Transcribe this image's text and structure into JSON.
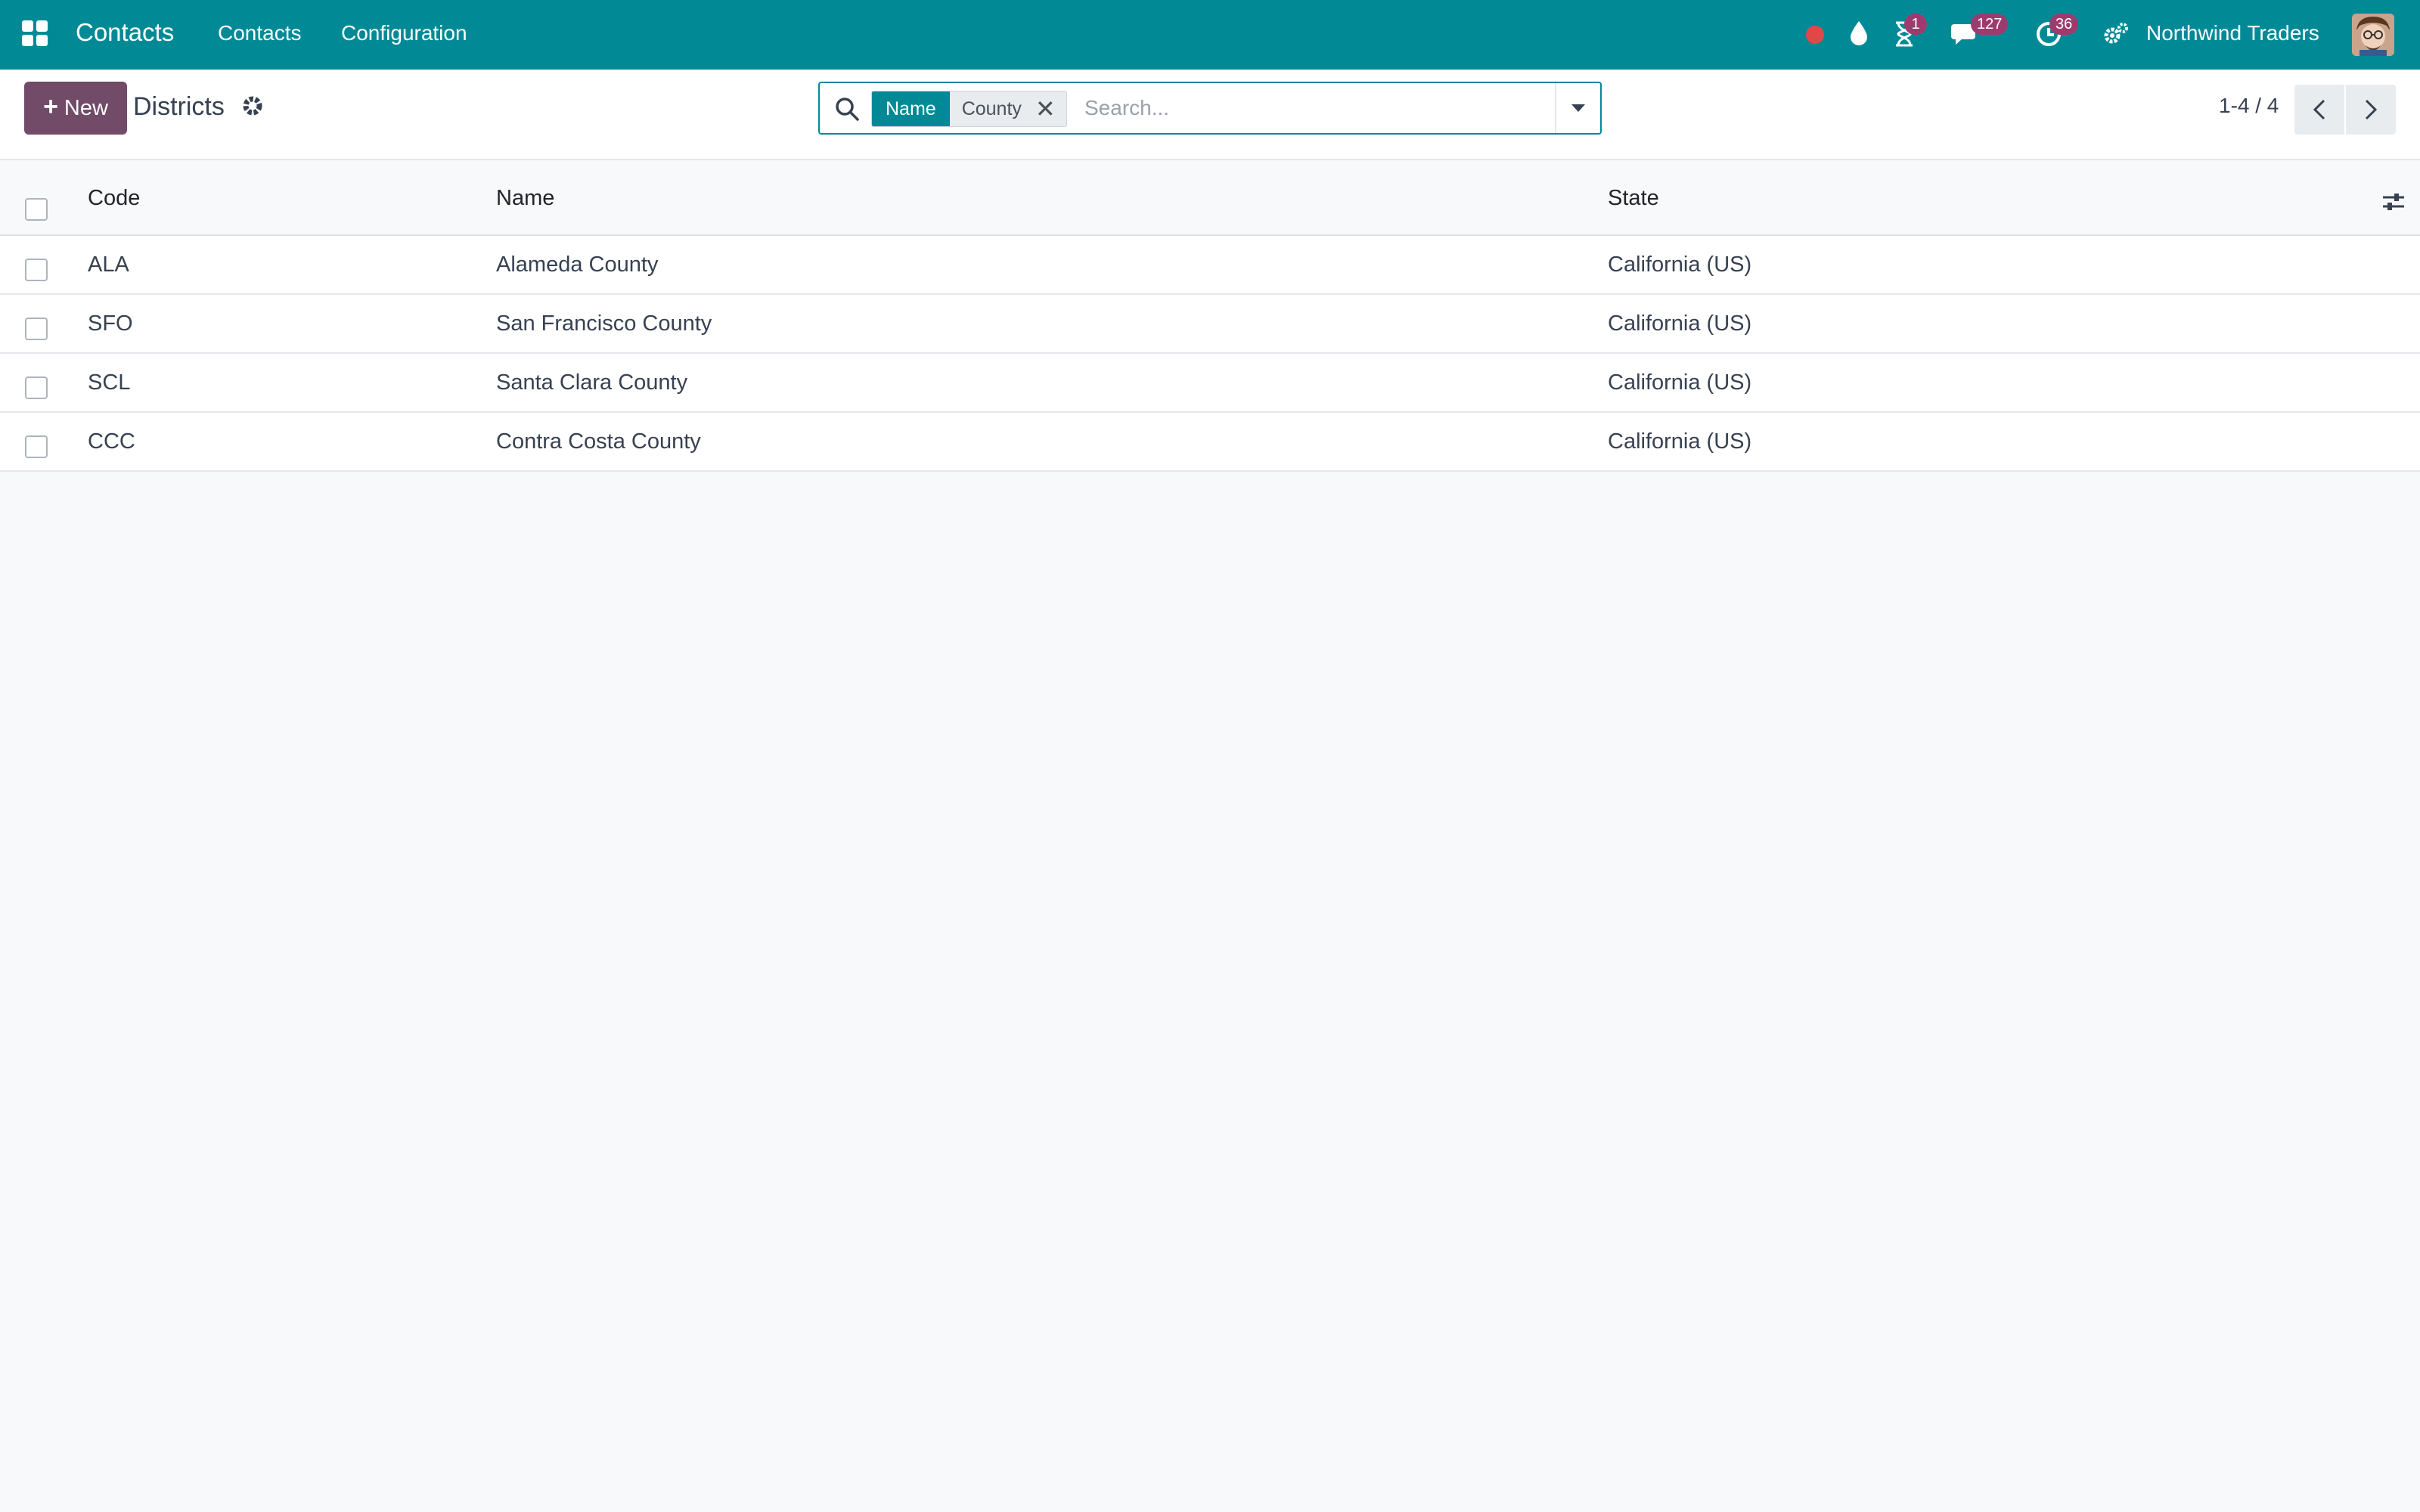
{
  "navbar": {
    "app_name": "Contacts",
    "menu": [
      "Contacts",
      "Configuration"
    ],
    "badges": {
      "activities": "1",
      "messages": "127",
      "clock": "36"
    },
    "company": "Northwind Traders",
    "accent": "#018a96"
  },
  "control_panel": {
    "new_label": "New",
    "title": "Districts",
    "search": {
      "facet_label": "Name",
      "facet_value": "County",
      "placeholder": "Search..."
    },
    "pager": "1-4 / 4"
  },
  "list": {
    "columns": [
      "Code",
      "Name",
      "State"
    ],
    "rows": [
      {
        "code": "ALA",
        "name": "Alameda County",
        "state": "California (US)"
      },
      {
        "code": "SFO",
        "name": "San Francisco County",
        "state": "California (US)"
      },
      {
        "code": "SCL",
        "name": "Santa Clara County",
        "state": "California (US)"
      },
      {
        "code": "CCC",
        "name": "Contra Costa County",
        "state": "California (US)"
      }
    ]
  }
}
